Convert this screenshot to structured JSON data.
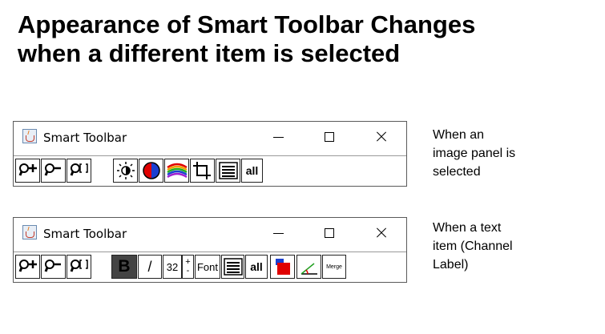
{
  "page": {
    "title_line1": "Appearance of Smart Toolbar Changes",
    "title_line2": "when a different item is selected"
  },
  "window1": {
    "title": "Smart Toolbar",
    "caption_lines": [
      "When an",
      "image panel is",
      "selected"
    ],
    "buttons": [
      "zoom-in-icon",
      "zoom-out-icon",
      "zoom-fit-icon",
      "brightness-icon",
      "color-mode-icon",
      "channel-colors-icon",
      "crop-icon",
      "align-icon"
    ],
    "all_label": "all"
  },
  "window2": {
    "title": "Smart Toolbar",
    "caption_lines": [
      "When a text",
      "item (Channel",
      "Label)"
    ],
    "bold_label": "B",
    "italic_label": "/",
    "font_size": "32",
    "plus_label": "+",
    "minus_label": "-",
    "font_label": "Font",
    "all_label": "all",
    "merge_label": "Merge"
  },
  "colors": {
    "accent_red": "#e00000",
    "accent_blue": "#1a3fd1",
    "dark_fill": "#444444"
  }
}
